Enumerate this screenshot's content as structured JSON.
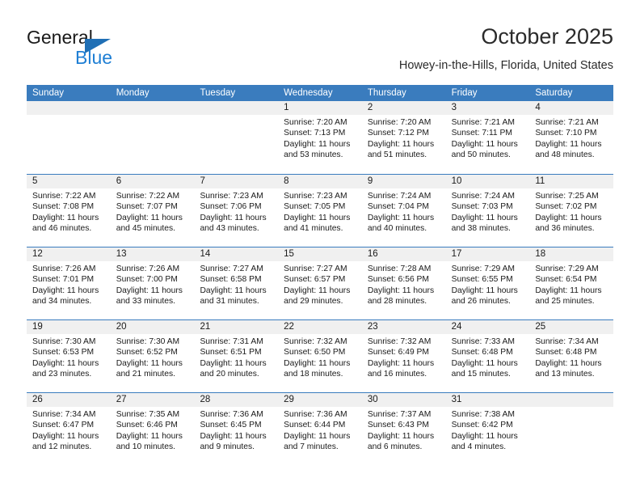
{
  "brand": {
    "name_top": "General",
    "name_bottom": "Blue",
    "triangle_color": "#1f6fb5",
    "text_color_top": "#1a1a1a",
    "text_color_bottom": "#1f7fd4"
  },
  "header": {
    "title": "October 2025",
    "subtitle": "Howey-in-the-Hills, Florida, United States"
  },
  "theme": {
    "header_bg": "#3a7cbe",
    "header_text": "#ffffff",
    "day_band_bg": "#f0f0f0",
    "row_border": "#3a7cbe"
  },
  "weekdays": [
    "Sunday",
    "Monday",
    "Tuesday",
    "Wednesday",
    "Thursday",
    "Friday",
    "Saturday"
  ],
  "weeks": [
    [
      {
        "day": "",
        "sunrise": "",
        "sunset": "",
        "daylight_l1": "",
        "daylight_l2": ""
      },
      {
        "day": "",
        "sunrise": "",
        "sunset": "",
        "daylight_l1": "",
        "daylight_l2": ""
      },
      {
        "day": "",
        "sunrise": "",
        "sunset": "",
        "daylight_l1": "",
        "daylight_l2": ""
      },
      {
        "day": "1",
        "sunrise": "Sunrise: 7:20 AM",
        "sunset": "Sunset: 7:13 PM",
        "daylight_l1": "Daylight: 11 hours",
        "daylight_l2": "and 53 minutes."
      },
      {
        "day": "2",
        "sunrise": "Sunrise: 7:20 AM",
        "sunset": "Sunset: 7:12 PM",
        "daylight_l1": "Daylight: 11 hours",
        "daylight_l2": "and 51 minutes."
      },
      {
        "day": "3",
        "sunrise": "Sunrise: 7:21 AM",
        "sunset": "Sunset: 7:11 PM",
        "daylight_l1": "Daylight: 11 hours",
        "daylight_l2": "and 50 minutes."
      },
      {
        "day": "4",
        "sunrise": "Sunrise: 7:21 AM",
        "sunset": "Sunset: 7:10 PM",
        "daylight_l1": "Daylight: 11 hours",
        "daylight_l2": "and 48 minutes."
      }
    ],
    [
      {
        "day": "5",
        "sunrise": "Sunrise: 7:22 AM",
        "sunset": "Sunset: 7:08 PM",
        "daylight_l1": "Daylight: 11 hours",
        "daylight_l2": "and 46 minutes."
      },
      {
        "day": "6",
        "sunrise": "Sunrise: 7:22 AM",
        "sunset": "Sunset: 7:07 PM",
        "daylight_l1": "Daylight: 11 hours",
        "daylight_l2": "and 45 minutes."
      },
      {
        "day": "7",
        "sunrise": "Sunrise: 7:23 AM",
        "sunset": "Sunset: 7:06 PM",
        "daylight_l1": "Daylight: 11 hours",
        "daylight_l2": "and 43 minutes."
      },
      {
        "day": "8",
        "sunrise": "Sunrise: 7:23 AM",
        "sunset": "Sunset: 7:05 PM",
        "daylight_l1": "Daylight: 11 hours",
        "daylight_l2": "and 41 minutes."
      },
      {
        "day": "9",
        "sunrise": "Sunrise: 7:24 AM",
        "sunset": "Sunset: 7:04 PM",
        "daylight_l1": "Daylight: 11 hours",
        "daylight_l2": "and 40 minutes."
      },
      {
        "day": "10",
        "sunrise": "Sunrise: 7:24 AM",
        "sunset": "Sunset: 7:03 PM",
        "daylight_l1": "Daylight: 11 hours",
        "daylight_l2": "and 38 minutes."
      },
      {
        "day": "11",
        "sunrise": "Sunrise: 7:25 AM",
        "sunset": "Sunset: 7:02 PM",
        "daylight_l1": "Daylight: 11 hours",
        "daylight_l2": "and 36 minutes."
      }
    ],
    [
      {
        "day": "12",
        "sunrise": "Sunrise: 7:26 AM",
        "sunset": "Sunset: 7:01 PM",
        "daylight_l1": "Daylight: 11 hours",
        "daylight_l2": "and 34 minutes."
      },
      {
        "day": "13",
        "sunrise": "Sunrise: 7:26 AM",
        "sunset": "Sunset: 7:00 PM",
        "daylight_l1": "Daylight: 11 hours",
        "daylight_l2": "and 33 minutes."
      },
      {
        "day": "14",
        "sunrise": "Sunrise: 7:27 AM",
        "sunset": "Sunset: 6:58 PM",
        "daylight_l1": "Daylight: 11 hours",
        "daylight_l2": "and 31 minutes."
      },
      {
        "day": "15",
        "sunrise": "Sunrise: 7:27 AM",
        "sunset": "Sunset: 6:57 PM",
        "daylight_l1": "Daylight: 11 hours",
        "daylight_l2": "and 29 minutes."
      },
      {
        "day": "16",
        "sunrise": "Sunrise: 7:28 AM",
        "sunset": "Sunset: 6:56 PM",
        "daylight_l1": "Daylight: 11 hours",
        "daylight_l2": "and 28 minutes."
      },
      {
        "day": "17",
        "sunrise": "Sunrise: 7:29 AM",
        "sunset": "Sunset: 6:55 PM",
        "daylight_l1": "Daylight: 11 hours",
        "daylight_l2": "and 26 minutes."
      },
      {
        "day": "18",
        "sunrise": "Sunrise: 7:29 AM",
        "sunset": "Sunset: 6:54 PM",
        "daylight_l1": "Daylight: 11 hours",
        "daylight_l2": "and 25 minutes."
      }
    ],
    [
      {
        "day": "19",
        "sunrise": "Sunrise: 7:30 AM",
        "sunset": "Sunset: 6:53 PM",
        "daylight_l1": "Daylight: 11 hours",
        "daylight_l2": "and 23 minutes."
      },
      {
        "day": "20",
        "sunrise": "Sunrise: 7:30 AM",
        "sunset": "Sunset: 6:52 PM",
        "daylight_l1": "Daylight: 11 hours",
        "daylight_l2": "and 21 minutes."
      },
      {
        "day": "21",
        "sunrise": "Sunrise: 7:31 AM",
        "sunset": "Sunset: 6:51 PM",
        "daylight_l1": "Daylight: 11 hours",
        "daylight_l2": "and 20 minutes."
      },
      {
        "day": "22",
        "sunrise": "Sunrise: 7:32 AM",
        "sunset": "Sunset: 6:50 PM",
        "daylight_l1": "Daylight: 11 hours",
        "daylight_l2": "and 18 minutes."
      },
      {
        "day": "23",
        "sunrise": "Sunrise: 7:32 AM",
        "sunset": "Sunset: 6:49 PM",
        "daylight_l1": "Daylight: 11 hours",
        "daylight_l2": "and 16 minutes."
      },
      {
        "day": "24",
        "sunrise": "Sunrise: 7:33 AM",
        "sunset": "Sunset: 6:48 PM",
        "daylight_l1": "Daylight: 11 hours",
        "daylight_l2": "and 15 minutes."
      },
      {
        "day": "25",
        "sunrise": "Sunrise: 7:34 AM",
        "sunset": "Sunset: 6:48 PM",
        "daylight_l1": "Daylight: 11 hours",
        "daylight_l2": "and 13 minutes."
      }
    ],
    [
      {
        "day": "26",
        "sunrise": "Sunrise: 7:34 AM",
        "sunset": "Sunset: 6:47 PM",
        "daylight_l1": "Daylight: 11 hours",
        "daylight_l2": "and 12 minutes."
      },
      {
        "day": "27",
        "sunrise": "Sunrise: 7:35 AM",
        "sunset": "Sunset: 6:46 PM",
        "daylight_l1": "Daylight: 11 hours",
        "daylight_l2": "and 10 minutes."
      },
      {
        "day": "28",
        "sunrise": "Sunrise: 7:36 AM",
        "sunset": "Sunset: 6:45 PM",
        "daylight_l1": "Daylight: 11 hours",
        "daylight_l2": "and 9 minutes."
      },
      {
        "day": "29",
        "sunrise": "Sunrise: 7:36 AM",
        "sunset": "Sunset: 6:44 PM",
        "daylight_l1": "Daylight: 11 hours",
        "daylight_l2": "and 7 minutes."
      },
      {
        "day": "30",
        "sunrise": "Sunrise: 7:37 AM",
        "sunset": "Sunset: 6:43 PM",
        "daylight_l1": "Daylight: 11 hours",
        "daylight_l2": "and 6 minutes."
      },
      {
        "day": "31",
        "sunrise": "Sunrise: 7:38 AM",
        "sunset": "Sunset: 6:42 PM",
        "daylight_l1": "Daylight: 11 hours",
        "daylight_l2": "and 4 minutes."
      },
      {
        "day": "",
        "sunrise": "",
        "sunset": "",
        "daylight_l1": "",
        "daylight_l2": ""
      }
    ]
  ]
}
